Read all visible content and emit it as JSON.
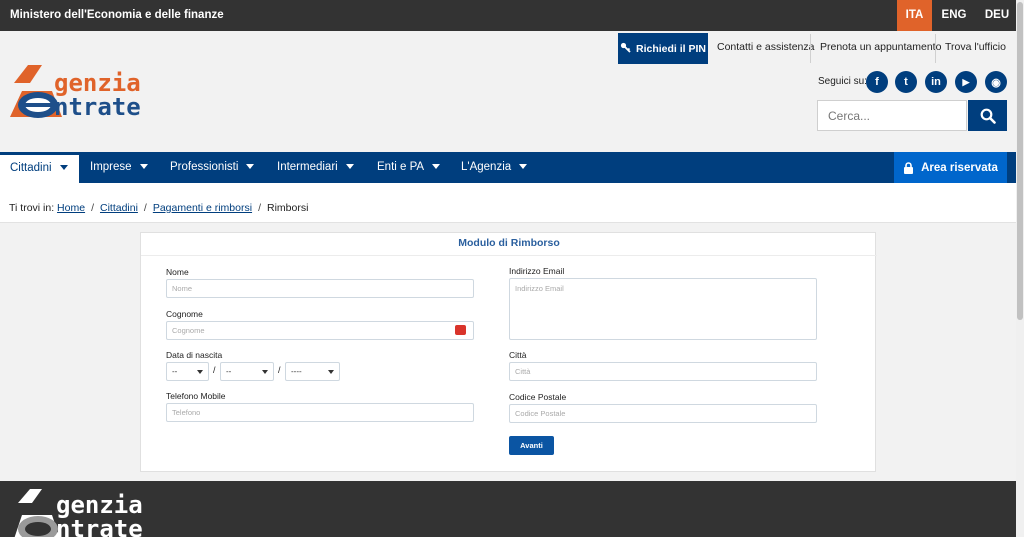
{
  "topbar": {
    "ministry": "Ministero dell'Economia e delle finanze",
    "languages": [
      "ITA",
      "ENG",
      "DEU"
    ],
    "active_language": "ITA"
  },
  "header": {
    "pin_button": "Richiedi il PIN",
    "links": [
      "Contatti e assistenza",
      "Prenota un appuntamento",
      "Trova l'ufficio"
    ],
    "follow_label": "Seguici su:",
    "social": [
      {
        "name": "facebook-icon",
        "glyph": "f"
      },
      {
        "name": "twitter-icon",
        "glyph": "t"
      },
      {
        "name": "linkedin-icon",
        "glyph": "in"
      },
      {
        "name": "youtube-icon",
        "glyph": "▶"
      },
      {
        "name": "rss-icon",
        "glyph": "◉"
      }
    ],
    "search_placeholder": "Cerca..."
  },
  "logo": {
    "line1": "genzia",
    "line2": "ntrate",
    "letter1": "A",
    "letter2": "E"
  },
  "nav": {
    "items": [
      "Cittadini",
      "Imprese",
      "Professionisti",
      "Intermediari",
      "Enti e PA",
      "L'Agenzia"
    ],
    "active": "Cittadini",
    "area_button": "Area riservata"
  },
  "breadcrumb": {
    "prefix": "Ti trovi in:",
    "items": [
      "Home",
      "Cittadini",
      "Pagamenti e rimborsi",
      "Rimborsi"
    ]
  },
  "form": {
    "title": "Modulo di Rimborso",
    "nome_label": "Nome",
    "nome_placeholder": "Nome",
    "cognome_label": "Cognome",
    "cognome_placeholder": "Cognome",
    "nascita_label": "Data di nascita",
    "day_value": "--",
    "month_value": "--",
    "year_value": "----",
    "telefono_label": "Telefono Mobile",
    "telefono_placeholder": "Telefono",
    "email_label": "Indirizzo Email",
    "email_placeholder": "Indirizzo Email",
    "citta_label": "Città",
    "citta_placeholder": "Città",
    "cap_label": "Codice Postale",
    "cap_placeholder": "Codice Postale",
    "submit": "Avanti"
  },
  "footer": {
    "line1": "genzia",
    "line2": "ntrate"
  },
  "colors": {
    "primary": "#003e7e",
    "accent": "#e0632a",
    "area": "#0066cc",
    "topbar": "#333333"
  }
}
